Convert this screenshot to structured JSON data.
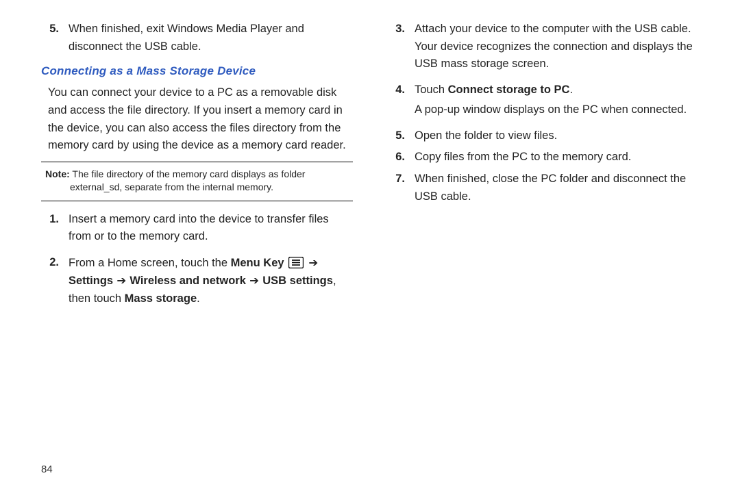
{
  "pageNumber": "84",
  "left": {
    "step5": {
      "num": "5.",
      "text": "When finished, exit Windows Media Player and disconnect the USB cable."
    },
    "heading": "Connecting as a Mass Storage Device",
    "intro": "You can connect your device to a PC as a removable disk and access the file directory. If you insert a memory card in the device, you can also access the files directory from the memory card by using the device as a memory card reader.",
    "note": {
      "label": "Note:",
      "text": "The file directory of the memory card displays as folder external_sd, separate from the internal memory."
    },
    "steps": {
      "s1": {
        "num": "1.",
        "text": "Insert a memory card into the device to transfer files from or to the memory card."
      },
      "s2": {
        "num": "2.",
        "pre": "From a Home screen, touch the ",
        "menu_key": "Menu Key",
        "arrow1": " ➔ ",
        "settings": "Settings",
        "arrow2": " ➔ ",
        "wireless": "Wireless and network",
        "arrow3": " ➔ ",
        "usb": "USB settings",
        "then": ", then touch ",
        "mass": "Mass storage",
        "period": "."
      }
    }
  },
  "right": {
    "s3": {
      "num": "3.",
      "text": "Attach your device to the computer with the USB cable. Your device recognizes the connection and displays the USB mass storage screen."
    },
    "s4": {
      "num": "4.",
      "pre": "Touch ",
      "bold": "Connect storage to PC",
      "period": ".",
      "after": "A pop-up window displays on the PC when connected."
    },
    "s5": {
      "num": "5.",
      "text": "Open the folder to view files."
    },
    "s6": {
      "num": "6.",
      "text": "Copy files from the PC to the memory card."
    },
    "s7": {
      "num": "7.",
      "text": "When finished, close the PC folder and disconnect the USB cable."
    }
  }
}
